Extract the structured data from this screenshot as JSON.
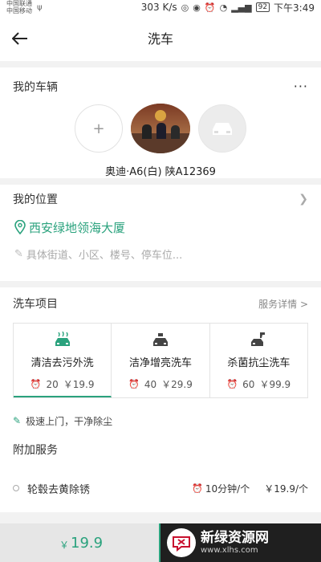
{
  "status_bar": {
    "carrier1": "中国联通",
    "carrier2": "中国移动",
    "speed": "303 K/s",
    "battery": "92",
    "time": "下午3:49"
  },
  "nav": {
    "title": "洗车",
    "back_icon": "arrow-left-icon"
  },
  "vehicle": {
    "section_title": "我的车辆",
    "more_icon": "more-dots-icon",
    "add_symbol": "+",
    "car_label": "奥迪·A6(白) 陕A12369"
  },
  "location": {
    "section_title": "我的位置",
    "address": "西安绿地领海大厦",
    "detail_placeholder": "具体街道、小区、楼号、停车位..."
  },
  "wash": {
    "section_title": "洗车项目",
    "detail_link": "服务详情 >",
    "accent_color": "#2aa27d",
    "items": [
      {
        "name": "清洁去污外洗",
        "duration": "20",
        "price": "￥19.9",
        "selected": true,
        "icon": "car-wash-icon"
      },
      {
        "name": "洁净增亮洗车",
        "duration": "40",
        "price": "￥29.9",
        "selected": false,
        "icon": "car-shine-icon"
      },
      {
        "name": "杀菌抗尘洗车",
        "duration": "60",
        "price": "￥99.9",
        "selected": false,
        "icon": "car-disinfect-icon"
      }
    ],
    "feature_text": "极速上门，干净除尘"
  },
  "extra": {
    "section_title": "附加服务",
    "items": [
      {
        "name": "轮毂去黄除锈",
        "time": "10分钟/个",
        "price": "￥19.9/个"
      }
    ]
  },
  "bottom": {
    "currency": "￥",
    "total": "19.9"
  },
  "watermark": {
    "title": "新绿资源网",
    "subtitle": "www.xlhs.com"
  }
}
